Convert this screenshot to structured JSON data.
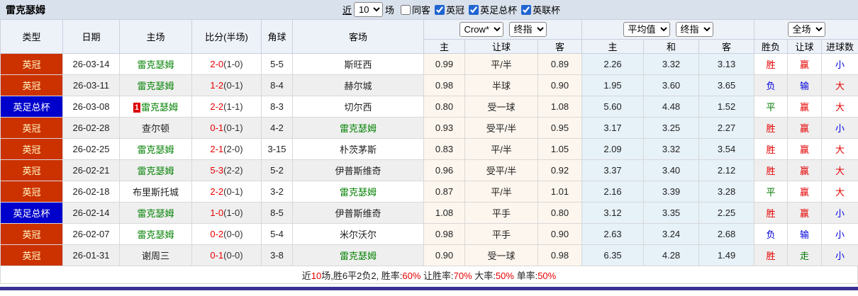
{
  "title": "雷克瑟姆",
  "controls": {
    "near_prefix": "近",
    "matches_suffix": "场",
    "recent_count": "10",
    "checkboxes": [
      {
        "label": "同客",
        "checked": false
      },
      {
        "label": "英冠",
        "checked": true
      },
      {
        "label": "英足总杯",
        "checked": true
      },
      {
        "label": "英联杯",
        "checked": true
      }
    ]
  },
  "selects": {
    "company": "Crow*",
    "company_period": "终指",
    "average": "平均值",
    "average_period": "终指",
    "scope": "全场"
  },
  "table": {
    "main_headers": [
      "类型",
      "日期",
      "主场",
      "比分(半场)",
      "角球",
      "客场"
    ],
    "sub_headers": [
      "主",
      "让球",
      "客",
      "主",
      "和",
      "客",
      "胜负",
      "让球",
      "进球数"
    ]
  },
  "rows": [
    {
      "type": "英冠",
      "type_color": "red",
      "date": "26-03-14",
      "home": "雷克瑟姆",
      "home_green": true,
      "home_badge": null,
      "score": "2-0",
      "half": "1-0",
      "corner": "5-5",
      "away": "斯旺西",
      "away_green": false,
      "crown": [
        "0.99",
        "平/半",
        "0.89"
      ],
      "avg": [
        "2.26",
        "3.32",
        "3.13"
      ],
      "outcome": {
        "text": "胜",
        "color": "red"
      },
      "handicap": {
        "text": "赢",
        "color": "red"
      },
      "goals": {
        "text": "小",
        "color": "blue"
      }
    },
    {
      "type": "英冠",
      "type_color": "red",
      "date": "26-03-11",
      "home": "雷克瑟姆",
      "home_green": true,
      "home_badge": null,
      "score": "1-2",
      "half": "0-1",
      "corner": "8-4",
      "away": "赫尔城",
      "away_green": false,
      "crown": [
        "0.98",
        "半球",
        "0.90"
      ],
      "avg": [
        "1.95",
        "3.60",
        "3.65"
      ],
      "outcome": {
        "text": "负",
        "color": "blue"
      },
      "handicap": {
        "text": "输",
        "color": "blue"
      },
      "goals": {
        "text": "大",
        "color": "red"
      }
    },
    {
      "type": "英足总杯",
      "type_color": "blue",
      "date": "26-03-08",
      "home": "雷克瑟姆",
      "home_green": true,
      "home_badge": "1",
      "score": "2-2",
      "half": "1-1",
      "corner": "8-3",
      "away": "切尔西",
      "away_green": false,
      "crown": [
        "0.80",
        "受一球",
        "1.08"
      ],
      "avg": [
        "5.60",
        "4.48",
        "1.52"
      ],
      "outcome": {
        "text": "平",
        "color": "green"
      },
      "handicap": {
        "text": "赢",
        "color": "red"
      },
      "goals": {
        "text": "大",
        "color": "red"
      }
    },
    {
      "type": "英冠",
      "type_color": "red",
      "date": "26-02-28",
      "home": "查尔顿",
      "home_green": false,
      "home_badge": null,
      "score": "0-1",
      "half": "0-1",
      "corner": "4-2",
      "away": "雷克瑟姆",
      "away_green": true,
      "crown": [
        "0.93",
        "受平/半",
        "0.95"
      ],
      "avg": [
        "3.17",
        "3.25",
        "2.27"
      ],
      "outcome": {
        "text": "胜",
        "color": "red"
      },
      "handicap": {
        "text": "赢",
        "color": "red"
      },
      "goals": {
        "text": "小",
        "color": "blue"
      }
    },
    {
      "type": "英冠",
      "type_color": "red",
      "date": "26-02-25",
      "home": "雷克瑟姆",
      "home_green": true,
      "home_badge": null,
      "score": "2-1",
      "half": "2-0",
      "corner": "3-15",
      "away": "朴茨茅斯",
      "away_green": false,
      "crown": [
        "0.83",
        "平/半",
        "1.05"
      ],
      "avg": [
        "2.09",
        "3.32",
        "3.54"
      ],
      "outcome": {
        "text": "胜",
        "color": "red"
      },
      "handicap": {
        "text": "赢",
        "color": "red"
      },
      "goals": {
        "text": "大",
        "color": "red"
      }
    },
    {
      "type": "英冠",
      "type_color": "red",
      "date": "26-02-21",
      "home": "雷克瑟姆",
      "home_green": true,
      "home_badge": null,
      "score": "5-3",
      "half": "2-2",
      "corner": "5-2",
      "away": "伊普斯维奇",
      "away_green": false,
      "crown": [
        "0.96",
        "受平/半",
        "0.92"
      ],
      "avg": [
        "3.37",
        "3.40",
        "2.12"
      ],
      "outcome": {
        "text": "胜",
        "color": "red"
      },
      "handicap": {
        "text": "赢",
        "color": "red"
      },
      "goals": {
        "text": "大",
        "color": "red"
      }
    },
    {
      "type": "英冠",
      "type_color": "red",
      "date": "26-02-18",
      "home": "布里斯托城",
      "home_green": false,
      "home_badge": null,
      "score": "2-2",
      "half": "0-1",
      "corner": "3-2",
      "away": "雷克瑟姆",
      "away_green": true,
      "crown": [
        "0.87",
        "平/半",
        "1.01"
      ],
      "avg": [
        "2.16",
        "3.39",
        "3.28"
      ],
      "outcome": {
        "text": "平",
        "color": "green"
      },
      "handicap": {
        "text": "赢",
        "color": "red"
      },
      "goals": {
        "text": "大",
        "color": "red"
      }
    },
    {
      "type": "英足总杯",
      "type_color": "blue",
      "date": "26-02-14",
      "home": "雷克瑟姆",
      "home_green": true,
      "home_badge": null,
      "score": "1-0",
      "half": "1-0",
      "corner": "8-5",
      "away": "伊普斯维奇",
      "away_green": false,
      "crown": [
        "1.08",
        "平手",
        "0.80"
      ],
      "avg": [
        "3.12",
        "3.35",
        "2.25"
      ],
      "outcome": {
        "text": "胜",
        "color": "red"
      },
      "handicap": {
        "text": "赢",
        "color": "red"
      },
      "goals": {
        "text": "小",
        "color": "blue"
      }
    },
    {
      "type": "英冠",
      "type_color": "red",
      "date": "26-02-07",
      "home": "雷克瑟姆",
      "home_green": true,
      "home_badge": null,
      "score": "0-2",
      "half": "0-0",
      "corner": "5-4",
      "away": "米尔沃尔",
      "away_green": false,
      "crown": [
        "0.98",
        "平手",
        "0.90"
      ],
      "avg": [
        "2.63",
        "3.24",
        "2.68"
      ],
      "outcome": {
        "text": "负",
        "color": "blue"
      },
      "handicap": {
        "text": "输",
        "color": "blue"
      },
      "goals": {
        "text": "小",
        "color": "blue"
      }
    },
    {
      "type": "英冠",
      "type_color": "red",
      "date": "26-01-31",
      "home": "谢周三",
      "home_green": false,
      "home_badge": null,
      "score": "0-1",
      "half": "0-0",
      "corner": "3-8",
      "away": "雷克瑟姆",
      "away_green": true,
      "crown": [
        "0.90",
        "受一球",
        "0.98"
      ],
      "avg": [
        "6.35",
        "4.28",
        "1.49"
      ],
      "outcome": {
        "text": "胜",
        "color": "red"
      },
      "handicap": {
        "text": "走",
        "color": "green"
      },
      "goals": {
        "text": "小",
        "color": "blue"
      }
    }
  ],
  "footer": {
    "segments": [
      {
        "text": "近",
        "red": false
      },
      {
        "text": "10",
        "red": true
      },
      {
        "text": "场,胜6平2负2, 胜率:",
        "red": false
      },
      {
        "text": "60%",
        "red": true
      },
      {
        "text": " 让胜率:",
        "red": false
      },
      {
        "text": "70%",
        "red": true
      },
      {
        "text": " 大率:",
        "red": false
      },
      {
        "text": "50%",
        "red": true
      },
      {
        "text": " 单率:",
        "red": false
      },
      {
        "text": "50%",
        "red": true
      }
    ]
  },
  "colors": {
    "league_red": "#cc3100",
    "league_red_text": "#ffffcc",
    "league_blue": "#0000cc",
    "league_blue_text": "#ffffff",
    "team_highlight": "#008000",
    "score_main": "#e60000",
    "score_half": "#333333",
    "value_red": "#e60000",
    "value_blue": "#0000dd",
    "value_green": "#007900",
    "crown_col_bg": "#fdf6ee",
    "avg_col_bg": "#e6f1f8",
    "stripe_bg": "#efefef",
    "badge_red": "#dd0000",
    "accent_bar": "#3c3292"
  }
}
